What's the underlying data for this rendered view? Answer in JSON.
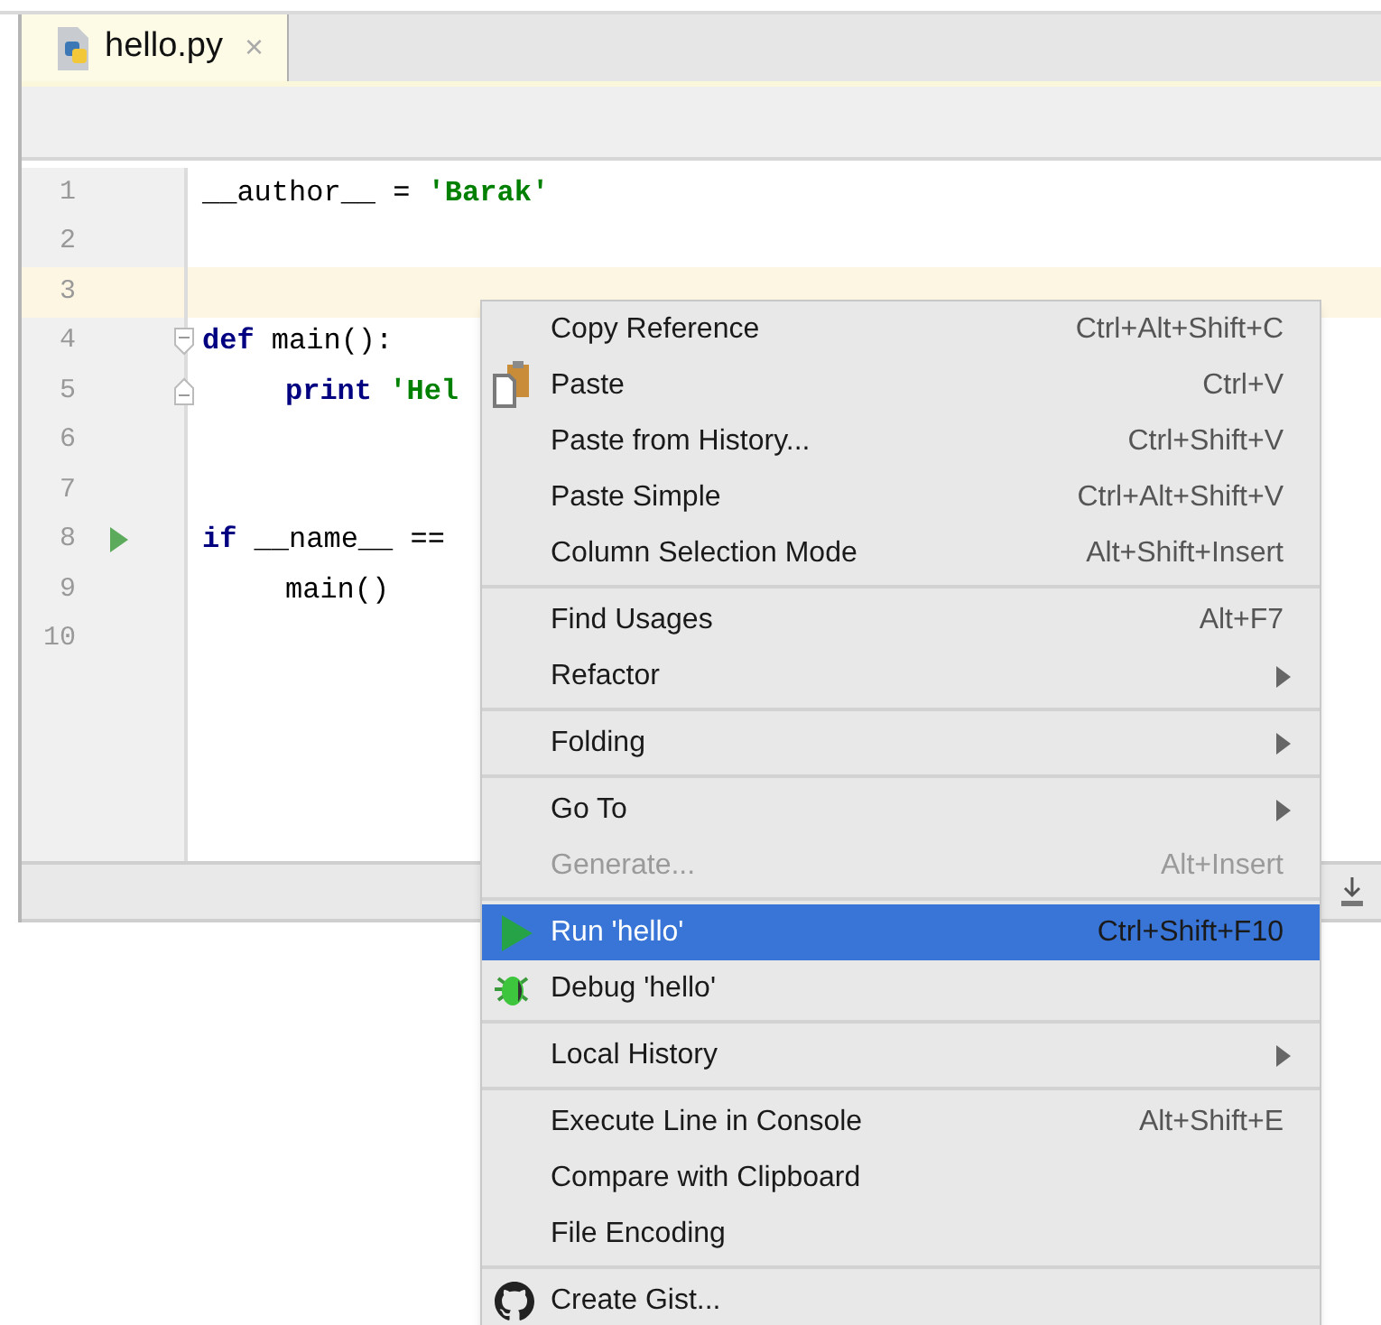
{
  "tabs": [
    {
      "label": "hello.py",
      "close": "×",
      "selected": true
    }
  ],
  "editor": {
    "lines": [
      {
        "number": "1",
        "current": false,
        "kind": "plain",
        "tokens": [
          {
            "kind": "plain",
            "text": "__author__ = "
          },
          {
            "kind": "string",
            "text": "'Barak'"
          }
        ]
      },
      {
        "number": "2",
        "current": false,
        "kind": "plain"
      },
      {
        "number": "3",
        "current": true,
        "kind": "plain"
      },
      {
        "number": "4",
        "current": false,
        "kind": "fold-start",
        "tokens": [
          {
            "kind": "keyword",
            "text": "def"
          },
          {
            "kind": "plain",
            "text": " main():"
          }
        ],
        "children": [
          {
            "number": "5",
            "current": false,
            "kind": "fold-end",
            "tokens": [
              {
                "kind": "keyword",
                "text": "print"
              },
              {
                "kind": "string",
                "text": " 'Hel"
              }
            ]
          }
        ]
      },
      {
        "number": "6",
        "current": false,
        "kind": "plain"
      },
      {
        "number": "7",
        "current": false,
        "kind": "plain"
      },
      {
        "number": "8",
        "current": false,
        "kind": "run",
        "tokens": [
          {
            "kind": "keyword",
            "text": "if"
          },
          {
            "kind": "plain",
            "text": " __name__ =="
          }
        ],
        "children": [
          {
            "number": "9",
            "current": false,
            "kind": "plain",
            "tokens": [
              {
                "kind": "plain",
                "text": "main()"
              }
            ]
          }
        ]
      },
      {
        "number": "10",
        "current": false,
        "kind": "plain"
      }
    ]
  },
  "context_menu": {
    "items": [
      {
        "kind": "item",
        "label": "Copy Reference",
        "shortcut": "Ctrl+Alt+Shift+C",
        "submenu": false,
        "disabled": false,
        "selected": false
      },
      {
        "kind": "paste",
        "label": "Paste",
        "shortcut": "Ctrl+V",
        "submenu": false,
        "disabled": false,
        "selected": false
      },
      {
        "kind": "item",
        "label": "Paste from History...",
        "shortcut": "Ctrl+Shift+V",
        "submenu": false,
        "disabled": false,
        "selected": false
      },
      {
        "kind": "item",
        "label": "Paste Simple",
        "shortcut": "Ctrl+Alt+Shift+V",
        "submenu": false,
        "disabled": false,
        "selected": false
      },
      {
        "kind": "item",
        "label": "Column Selection Mode",
        "shortcut": "Alt+Shift+Insert",
        "submenu": false,
        "disabled": false,
        "selected": false
      },
      {
        "kind": "separator"
      },
      {
        "kind": "item",
        "label": "Find Usages",
        "shortcut": "Alt+F7",
        "submenu": false,
        "disabled": false,
        "selected": false
      },
      {
        "kind": "item",
        "label": "Refactor",
        "submenu": true,
        "disabled": false,
        "selected": false
      },
      {
        "kind": "separator"
      },
      {
        "kind": "item",
        "label": "Folding",
        "submenu": true,
        "disabled": false,
        "selected": false
      },
      {
        "kind": "separator"
      },
      {
        "kind": "item",
        "label": "Go To",
        "submenu": true,
        "disabled": false,
        "selected": false
      },
      {
        "kind": "item",
        "label": "Generate...",
        "shortcut": "Alt+Insert",
        "submenu": false,
        "disabled": true,
        "selected": false
      },
      {
        "kind": "separator"
      },
      {
        "kind": "run",
        "label": "Run 'hello'",
        "shortcut": "Ctrl+Shift+F10",
        "submenu": false,
        "disabled": false,
        "selected": true
      },
      {
        "kind": "debug",
        "label": "Debug 'hello'",
        "submenu": false,
        "disabled": false,
        "selected": false
      },
      {
        "kind": "separator"
      },
      {
        "kind": "item",
        "label": "Local History",
        "submenu": true,
        "disabled": false,
        "selected": false
      },
      {
        "kind": "separator"
      },
      {
        "kind": "item",
        "label": "Execute Line in Console",
        "shortcut": "Alt+Shift+E",
        "submenu": false,
        "disabled": false,
        "selected": false
      },
      {
        "kind": "item",
        "label": "Compare with Clipboard",
        "submenu": false,
        "disabled": false,
        "selected": false
      },
      {
        "kind": "item",
        "label": "File Encoding",
        "submenu": false,
        "disabled": false,
        "selected": false
      },
      {
        "kind": "separator"
      },
      {
        "kind": "gist",
        "label": "Create Gist...",
        "submenu": false,
        "disabled": false,
        "selected": false
      }
    ]
  }
}
